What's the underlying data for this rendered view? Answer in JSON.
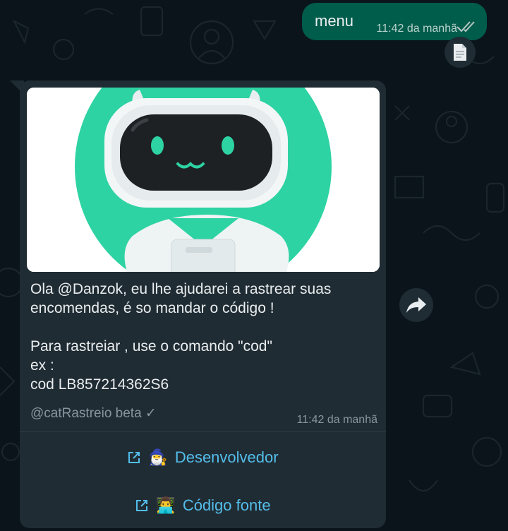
{
  "outgoing": {
    "text": "menu",
    "time": "11:42 da manhã",
    "status_icon": "double-check-icon"
  },
  "incoming": {
    "image_icon": "robot-mascot-image",
    "message": "Ola @Danzok, eu lhe ajudarei a rastrear suas encomendas, é so mandar o código !\n\nPara rastreiar , use o comando \"cod\"\nex :\ncod LB857214362S6",
    "footer": "@catRastreio beta ✓",
    "time": "11:42 da manhã",
    "buttons": [
      {
        "emoji": "🧙‍♂️",
        "label": "Desenvolvedor",
        "icon": "external-link-icon"
      },
      {
        "emoji": "👨‍💻",
        "label": "Código fonte",
        "icon": "external-link-icon"
      }
    ]
  },
  "colors": {
    "background": "#0b141a",
    "outgoing_bubble": "#005c4b",
    "incoming_bubble": "#202c33",
    "link": "#53bdeb",
    "mascot_green": "#2ed3a3"
  }
}
